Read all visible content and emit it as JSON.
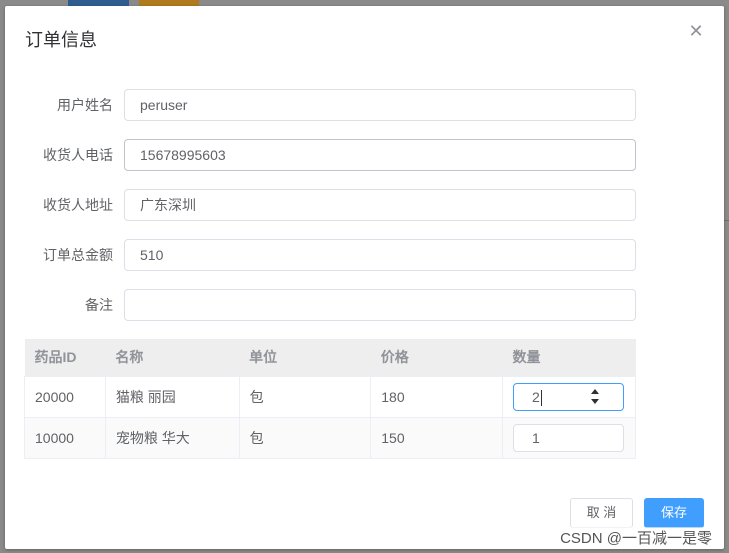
{
  "dialog": {
    "title": "订单信息",
    "close_icon": "close-icon"
  },
  "form": {
    "username_label": "用户姓名",
    "username_value": "peruser",
    "phone_label": "收货人电话",
    "phone_value": "15678995603",
    "address_label": "收货人地址",
    "address_value": "广东深圳",
    "total_label": "订单总金额",
    "total_value": "510",
    "remark_label": "备注",
    "remark_value": ""
  },
  "table": {
    "headers": [
      "药品ID",
      "名称",
      "单位",
      "价格",
      "数量"
    ],
    "rows": [
      {
        "id": "20000",
        "name": "猫粮 丽园",
        "unit": "包",
        "price": "180",
        "qty": "2"
      },
      {
        "id": "10000",
        "name": "宠物粮 华大",
        "unit": "包",
        "price": "150",
        "qty": "1"
      }
    ]
  },
  "buttons": {
    "cancel": "取 消",
    "save": "保存"
  },
  "watermark": "CSDN @一百减一是零"
}
